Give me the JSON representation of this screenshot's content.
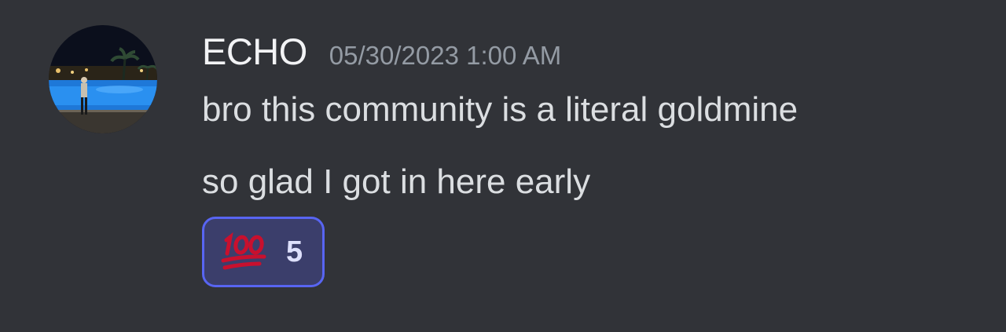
{
  "message": {
    "author": "ECHO",
    "timestamp": "05/30/2023 1:00 AM",
    "lines": [
      "bro this community is a literal goldmine",
      "so glad I got in here early"
    ],
    "reactions": [
      {
        "emoji": "hundred-points-icon",
        "count": "5"
      }
    ]
  },
  "colors": {
    "background": "#313338",
    "username": "#f2f3f5",
    "timestamp": "#949ba4",
    "text": "#dbdee1",
    "reaction_border": "#5865f2",
    "reaction_bg": "#3b3e6b",
    "emoji_red": "#c8102e"
  }
}
